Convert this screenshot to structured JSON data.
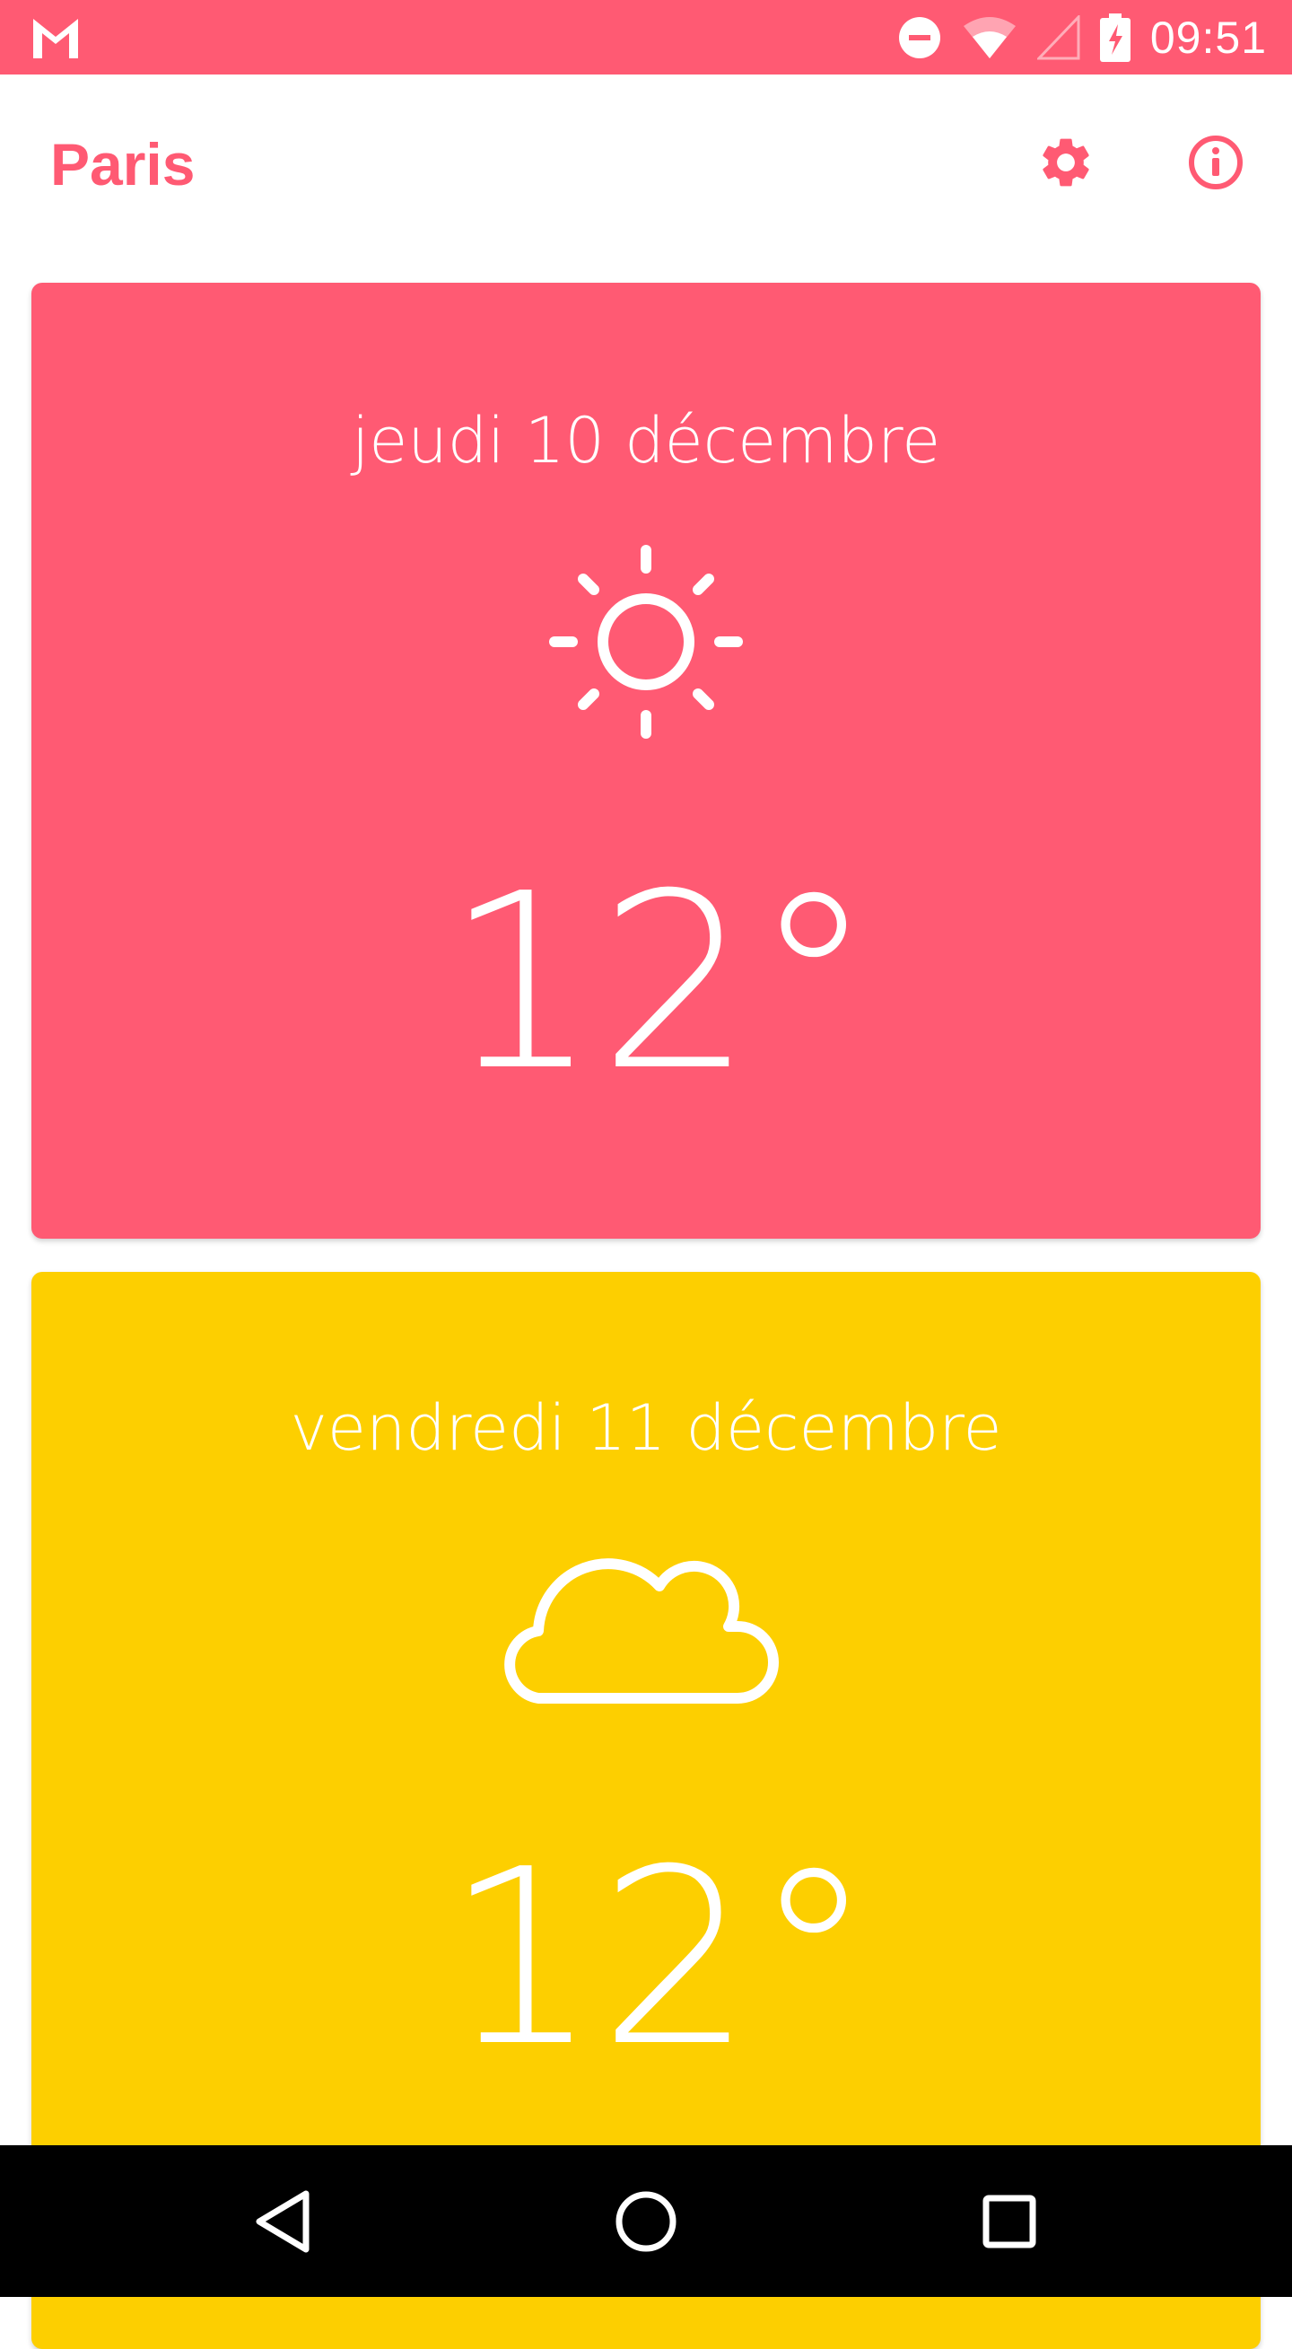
{
  "status_bar": {
    "time": "09:51",
    "background": "#ff5a73",
    "icons": [
      "gmail-icon",
      "dnd-icon",
      "wifi-icon",
      "signal-icon",
      "battery-charging-icon"
    ]
  },
  "app_bar": {
    "city": "Paris",
    "accent_color": "#ff5a73",
    "actions": [
      "settings-icon",
      "info-icon"
    ]
  },
  "forecast": [
    {
      "date": "jeudi 10 décembre",
      "icon": "sun-icon",
      "temperature": "12°",
      "color": "#ff5a73"
    },
    {
      "date": "vendredi 11 décembre",
      "icon": "cloud-icon",
      "temperature": "12°",
      "color": "#fdcf00"
    }
  ],
  "nav_bar": {
    "buttons": [
      "back-icon",
      "home-icon",
      "recents-icon"
    ]
  }
}
